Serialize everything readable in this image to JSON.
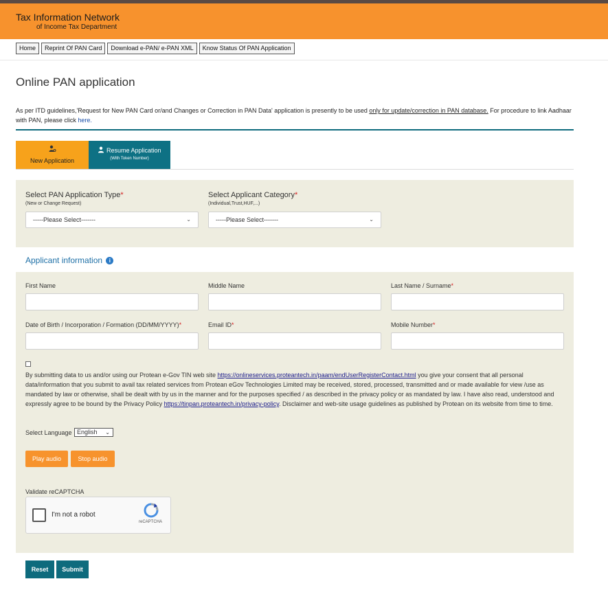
{
  "header": {
    "title": "Tax Information Network",
    "subtitle": "of Income Tax Department"
  },
  "nav": {
    "items": [
      "Home",
      "Reprint Of PAN Card",
      "Download e-PAN/ e-PAN XML",
      "Know Status Of PAN Application"
    ]
  },
  "page": {
    "title": "Online PAN application",
    "notice_part1": "As per ITD guidelines,'Request for New PAN Card or/and Changes or Correction in PAN Data' application is presently to be used ",
    "notice_underlined": "only for update/correction in PAN database.",
    "notice_part2": " For procedure to link Aadhaar with PAN, please click ",
    "notice_link": "here."
  },
  "tabs": {
    "new_label": "New Application",
    "resume_label": "Resume Application",
    "resume_sub": "(With Token Number)"
  },
  "application_type": {
    "label": "Select PAN Application Type",
    "required": "*",
    "hint": "(New or Change Request)",
    "value": "-----Please Select-------"
  },
  "applicant_category": {
    "label": "Select Applicant Category",
    "required": "*",
    "hint": "(Individual,Trust,HUF,...)",
    "value": "-----Please Select-------"
  },
  "applicant_info": {
    "title": "Applicant information",
    "info_icon_glyph": "i",
    "fields": {
      "first_name": "First Name",
      "middle_name": "Middle Name",
      "last_name": "Last Name / Surname",
      "dob": "Date of Birth / Incorporation / Formation (DD/MM/YYYY)",
      "email": "Email ID",
      "mobile": "Mobile Number"
    },
    "required_mark": "*"
  },
  "consent": {
    "text1": "By submitting data to us and/or using our Protean e-Gov TIN web site ",
    "link1": "https://onlineservices.proteantech.in/paam/endUserRegisterContact.html",
    "text2": " you give your consent that all personal data/information that you submit to avail tax related services from Protean eGov Technologies Limited may be received, stored, processed, transmitted and or made available for view /use as mandated by law or otherwise, shall be dealt with by us in the manner and for the purposes specified / as described in the privacy policy or as mandated by law. I have also read, understood and expressly agree to be bound by the Privacy Policy ",
    "link2": "https://tinpan.proteantech.in/privacy-policy",
    "text3": ". Disclaimer and web-site usage guidelines as published by Protean on its website from time to time."
  },
  "language": {
    "label": "Select Language",
    "value": "English"
  },
  "audio": {
    "play": "Play audio",
    "stop": "Stop audio"
  },
  "captcha": {
    "label": "Validate reCAPTCHA",
    "text": "I'm not a robot",
    "brand": "reCAPTCHA"
  },
  "actions": {
    "reset": "Reset",
    "submit": "Submit"
  },
  "colors": {
    "header": "#f7922d",
    "teal": "#0e6b7d",
    "tab_active": "#f7a21b",
    "panel": "#eeede0"
  }
}
